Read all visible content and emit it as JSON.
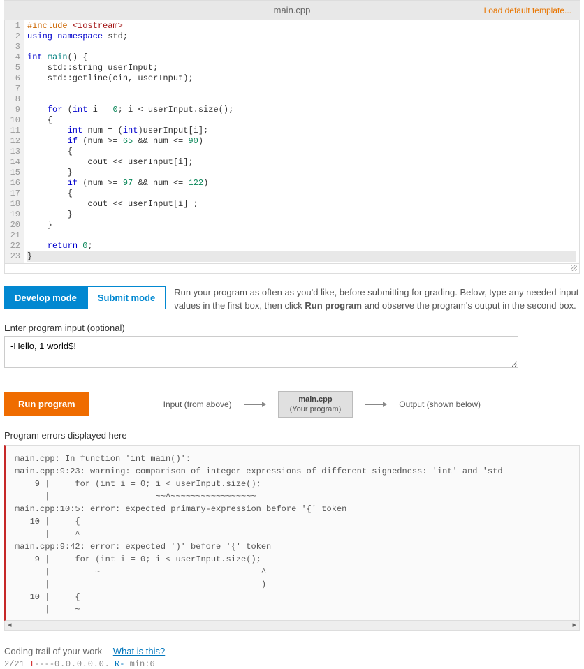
{
  "header": {
    "filename": "main.cpp",
    "load_template": "Load default template..."
  },
  "code": {
    "lines": [
      {
        "n": "1",
        "html": "<span class='pre'>#include</span> <span class='str'>&lt;iostream&gt;</span>"
      },
      {
        "n": "2",
        "html": "<span class='kw'>using</span> <span class='kw'>namespace</span> std;"
      },
      {
        "n": "3",
        "html": ""
      },
      {
        "n": "4",
        "html": "<span class='kw'>int</span> <span class='typ'>main</span>() {"
      },
      {
        "n": "5",
        "html": "    std::string userInput;"
      },
      {
        "n": "6",
        "html": "    std::getline(cin, userInput);"
      },
      {
        "n": "7",
        "html": ""
      },
      {
        "n": "8",
        "html": ""
      },
      {
        "n": "9",
        "html": "    <span class='kw'>for</span> (<span class='kw'>int</span> i = <span class='num'>0</span>; i &lt; userInput.size();"
      },
      {
        "n": "10",
        "html": "    {"
      },
      {
        "n": "11",
        "html": "        <span class='kw'>int</span> num = (<span class='kw'>int</span>)userInput[i];"
      },
      {
        "n": "12",
        "html": "        <span class='kw'>if</span> (num &gt;= <span class='num'>65</span> &amp;&amp; num &lt;= <span class='num'>90</span>)"
      },
      {
        "n": "13",
        "html": "        {"
      },
      {
        "n": "14",
        "html": "            cout &lt;&lt; userInput[i];"
      },
      {
        "n": "15",
        "html": "        }"
      },
      {
        "n": "16",
        "html": "        <span class='kw'>if</span> (num &gt;= <span class='num'>97</span> &amp;&amp; num &lt;= <span class='num'>122</span>)"
      },
      {
        "n": "17",
        "html": "        {"
      },
      {
        "n": "18",
        "html": "            cout &lt;&lt; userInput[i] ;"
      },
      {
        "n": "19",
        "html": "        }"
      },
      {
        "n": "20",
        "html": "    }"
      },
      {
        "n": "21",
        "html": ""
      },
      {
        "n": "22",
        "html": "    <span class='kw'>return</span> <span class='num'>0</span>;"
      },
      {
        "n": "23",
        "html": "}",
        "hl": true
      }
    ]
  },
  "modes": {
    "develop": "Develop mode",
    "submit": "Submit mode",
    "description_pre": "Run your program as often as you'd like, before submitting for grading. Below, type any needed input values in the first box, then click ",
    "description_bold": "Run program",
    "description_post": " and observe the program's output in the second box."
  },
  "input": {
    "label": "Enter program input (optional)",
    "value": "-Hello, 1 world$!"
  },
  "run": {
    "button": "Run program",
    "input_label": "Input (from above)",
    "box_title": "main.cpp",
    "box_sub": "(Your program)",
    "output_label": "Output (shown below)"
  },
  "errors": {
    "label": "Program errors displayed here",
    "text": "main.cpp: In function 'int main()':\nmain.cpp:9:23: warning: comparison of integer expressions of different signedness: 'int' and 'std\n    9 |     for (int i = 0; i < userInput.size();\n      |                     ~~^~~~~~~~~~~~~~~~~~\nmain.cpp:10:5: error: expected primary-expression before '{' token\n   10 |     {\n      |     ^\nmain.cpp:9:42: error: expected ')' before '{' token\n    9 |     for (int i = 0; i < userInput.size();\n      |         ~                                ^\n      |                                          )\n   10 |     {\n      |     ~"
  },
  "trail": {
    "label": "Coding trail of your work",
    "link": "What is this?",
    "date": "2/21",
    "seq1": "T",
    "dashes": "----",
    "zeros": "0,,0,,0,,0,,0,",
    "seq2": "R-",
    "mins": " min:6"
  }
}
